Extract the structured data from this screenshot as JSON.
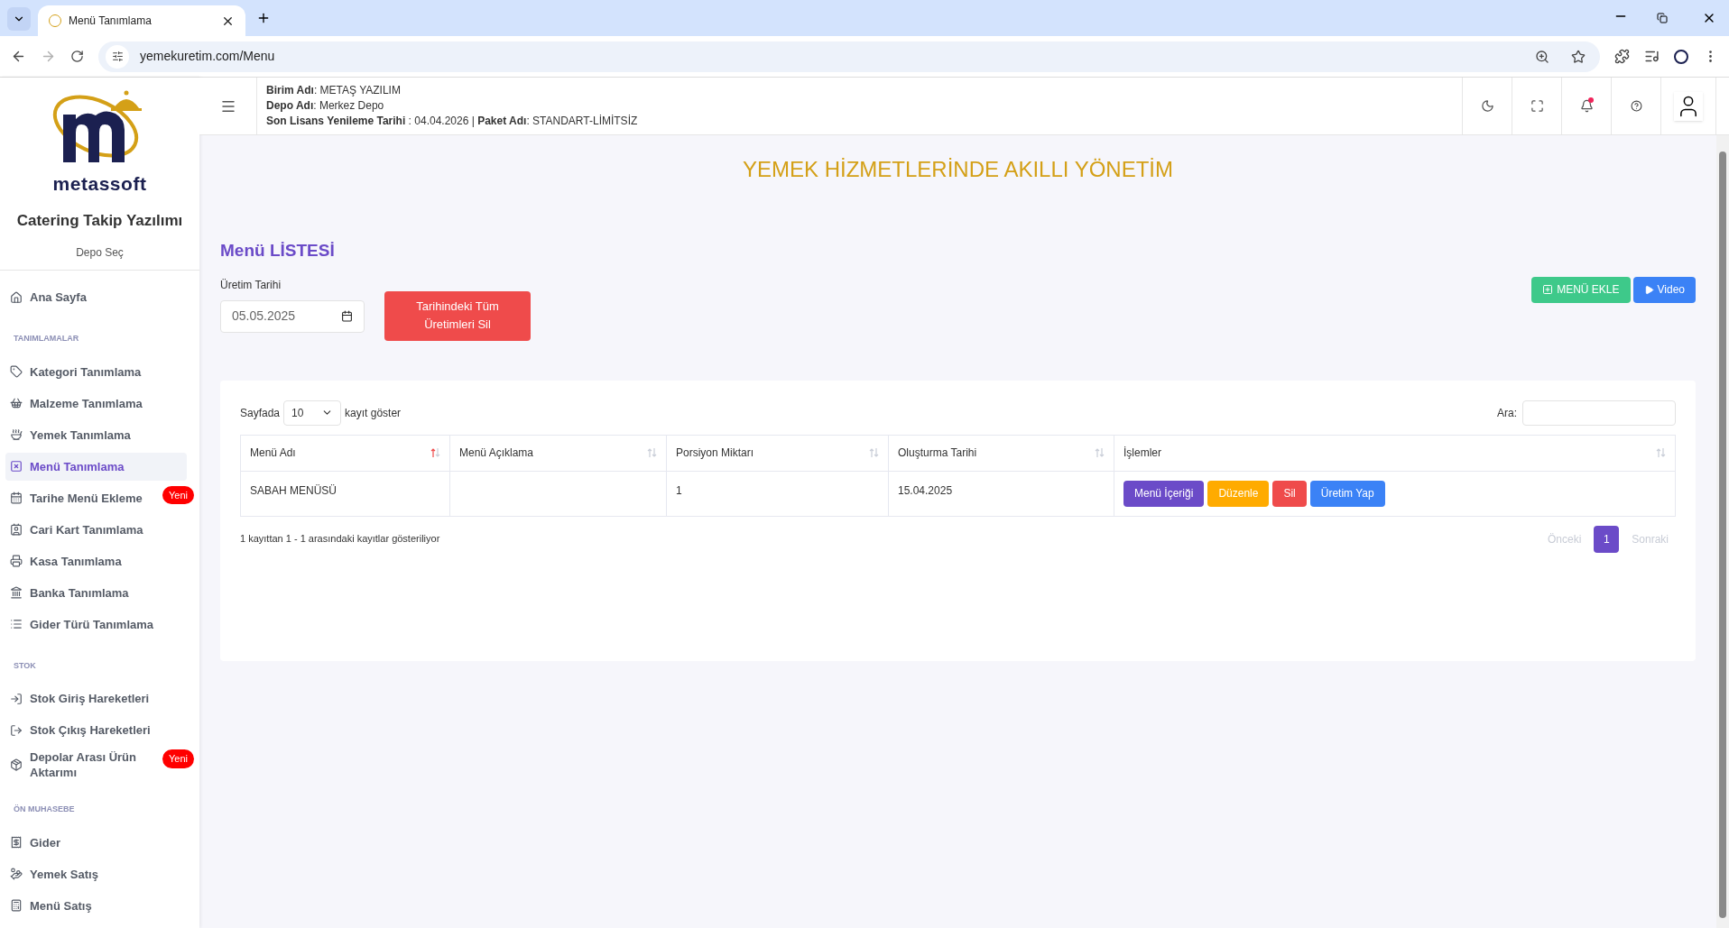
{
  "browser": {
    "tab_title": "Menü Tanımlama",
    "url": "yemekuretim.com/Menu"
  },
  "sidebar": {
    "brand": "metassoft",
    "app_name": "Catering Takip Yazılımı",
    "depot_link": "Depo Seç",
    "sections": [
      {
        "items": [
          {
            "label": "Ana Sayfa",
            "selected": false
          }
        ]
      },
      {
        "heading": "TANIMLAMALAR",
        "items": [
          {
            "label": "Kategori Tanımlama",
            "selected": false
          },
          {
            "label": "Malzeme Tanımlama",
            "selected": false
          },
          {
            "label": "Yemek Tanımlama",
            "selected": false
          },
          {
            "label": "Menü Tanımlama",
            "selected": true
          },
          {
            "label": "Tarihe Menü Ekleme",
            "selected": false,
            "badge": "Yeni"
          },
          {
            "label": "Cari Kart Tanımlama",
            "selected": false
          },
          {
            "label": "Kasa Tanımlama",
            "selected": false
          },
          {
            "label": "Banka Tanımlama",
            "selected": false
          },
          {
            "label": "Gider Türü Tanımlama",
            "selected": false
          }
        ]
      },
      {
        "heading": "STOK",
        "items": [
          {
            "label": "Stok Giriş Hareketleri",
            "selected": false
          },
          {
            "label": "Stok Çıkış Hareketleri",
            "selected": false
          },
          {
            "label": "Depolar Arası Ürün Aktarımı",
            "selected": false,
            "badge": "Yeni"
          }
        ]
      },
      {
        "heading": "ÖN MUHASEBE",
        "items": [
          {
            "label": "Gider",
            "selected": false
          },
          {
            "label": "Yemek Satış",
            "selected": false
          },
          {
            "label": "Menü Satış",
            "selected": false
          }
        ]
      }
    ]
  },
  "header": {
    "info_lines": [
      [
        {
          "label": "Birim Adı",
          "value": ": METAŞ YAZILIM"
        }
      ],
      [
        {
          "label": "Depo Adı",
          "value": ": Merkez Depo"
        }
      ],
      [
        {
          "label": "Son Lisans Yenileme Tarihi",
          "value": " : 04.04.2026 | "
        },
        {
          "label": "Paket Adı",
          "value": ": STANDART-LİMİTSİZ"
        }
      ]
    ],
    "notification": true
  },
  "banner": "YEMEK HİZMETLERİNDE AKILLI YÖNETİM",
  "list_title": "Menü LİSTESİ",
  "date_field": {
    "label": "Üretim Tarihi",
    "value": "05.05.2025"
  },
  "delete_button": "Tarihindeki Tüm Üretimleri Sil",
  "add_button": "MENÜ EKLE",
  "video_button": "Video",
  "table": {
    "page_size_before": "Sayfada",
    "page_size": "10",
    "page_size_after": "kayıt göster",
    "search_label": "Ara:",
    "columns": [
      {
        "label": "Menü Adı",
        "sorted": true
      },
      {
        "label": "Menü Açıklama",
        "sorted": false
      },
      {
        "label": "Porsiyon Miktarı",
        "sorted": false
      },
      {
        "label": "Oluşturma Tarihi",
        "sorted": false
      },
      {
        "label": "İşlemler",
        "sorted": false
      }
    ],
    "rows": [
      {
        "cells": [
          "SABAH MENÜSÜ",
          "",
          "1",
          "15.04.2025"
        ],
        "actions": [
          {
            "label": "Menü İçeriği",
            "color": "#6b4bc8"
          },
          {
            "label": "Düzenle",
            "color": "#ffab00"
          },
          {
            "label": "Sil",
            "color": "#ef4b4b"
          },
          {
            "label": "Üretim Yap",
            "color": "#3b82f6"
          }
        ]
      }
    ],
    "info": "1 kayıttan 1 - 1 arasındaki kayıtlar gösteriliyor",
    "pagination": {
      "prev": {
        "label": "Önceki",
        "disabled": true
      },
      "pages": [
        {
          "label": "1",
          "selected": true
        }
      ],
      "next": {
        "label": "Sonraki",
        "disabled": true
      }
    }
  }
}
